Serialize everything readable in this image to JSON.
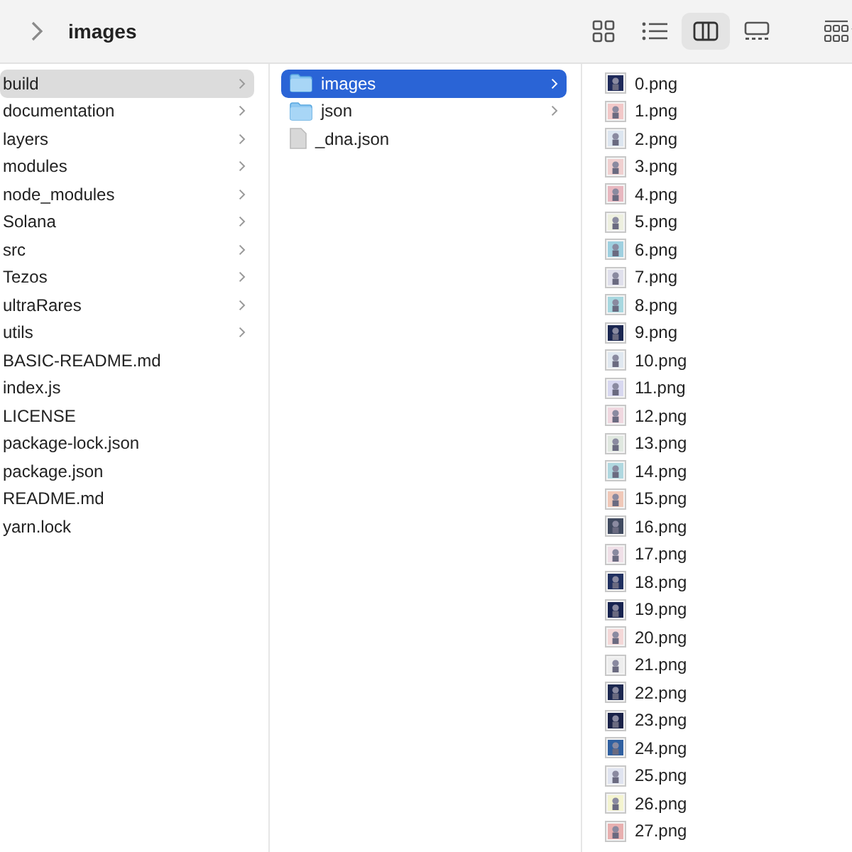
{
  "toolbar": {
    "title": "images",
    "views": [
      {
        "kind": "icons",
        "selected": false
      },
      {
        "kind": "list",
        "selected": false
      },
      {
        "kind": "columns",
        "selected": true
      },
      {
        "kind": "gallery",
        "selected": false
      }
    ]
  },
  "columns": [
    {
      "items": [
        {
          "name": "build",
          "kind": "folder",
          "selected": true
        },
        {
          "name": "documentation",
          "kind": "folder",
          "selected": false
        },
        {
          "name": "layers",
          "kind": "folder",
          "selected": false
        },
        {
          "name": "modules",
          "kind": "folder",
          "selected": false
        },
        {
          "name": "node_modules",
          "kind": "folder",
          "selected": false
        },
        {
          "name": "Solana",
          "kind": "folder",
          "selected": false
        },
        {
          "name": "src",
          "kind": "folder",
          "selected": false
        },
        {
          "name": "Tezos",
          "kind": "folder",
          "selected": false
        },
        {
          "name": "ultraRares",
          "kind": "folder",
          "selected": false
        },
        {
          "name": "utils",
          "kind": "folder",
          "selected": false
        },
        {
          "name": "BASIC-README.md",
          "kind": "file",
          "selected": false
        },
        {
          "name": "index.js",
          "kind": "file",
          "selected": false
        },
        {
          "name": "LICENSE",
          "kind": "file",
          "selected": false
        },
        {
          "name": "package-lock.json",
          "kind": "file",
          "selected": false
        },
        {
          "name": "package.json",
          "kind": "file",
          "selected": false
        },
        {
          "name": "README.md",
          "kind": "file",
          "selected": false
        },
        {
          "name": "yarn.lock",
          "kind": "file",
          "selected": false
        }
      ]
    },
    {
      "items": [
        {
          "name": "images",
          "kind": "folder",
          "selected": true
        },
        {
          "name": "json",
          "kind": "folder",
          "selected": false
        },
        {
          "name": "_dna.json",
          "kind": "file",
          "selected": false
        }
      ]
    },
    {
      "items": [
        {
          "name": "0.png",
          "kind": "image",
          "selected": false,
          "color": "#1f2a5a"
        },
        {
          "name": "1.png",
          "kind": "image",
          "selected": false,
          "color": "#f2c8c8"
        },
        {
          "name": "2.png",
          "kind": "image",
          "selected": false,
          "color": "#dde6f0"
        },
        {
          "name": "3.png",
          "kind": "image",
          "selected": false,
          "color": "#f0d0d0"
        },
        {
          "name": "4.png",
          "kind": "image",
          "selected": false,
          "color": "#e8b8c0"
        },
        {
          "name": "5.png",
          "kind": "image",
          "selected": false,
          "color": "#eef0e0"
        },
        {
          "name": "6.png",
          "kind": "image",
          "selected": false,
          "color": "#9fd0e0"
        },
        {
          "name": "7.png",
          "kind": "image",
          "selected": false,
          "color": "#e0e0ec"
        },
        {
          "name": "8.png",
          "kind": "image",
          "selected": false,
          "color": "#a8d8e0"
        },
        {
          "name": "9.png",
          "kind": "image",
          "selected": false,
          "color": "#1a2650"
        },
        {
          "name": "10.png",
          "kind": "image",
          "selected": false,
          "color": "#e0e8f0"
        },
        {
          "name": "11.png",
          "kind": "image",
          "selected": false,
          "color": "#d8d8f0"
        },
        {
          "name": "12.png",
          "kind": "image",
          "selected": false,
          "color": "#f0d8e0"
        },
        {
          "name": "13.png",
          "kind": "image",
          "selected": false,
          "color": "#e0e8e0"
        },
        {
          "name": "14.png",
          "kind": "image",
          "selected": false,
          "color": "#b0d8e0"
        },
        {
          "name": "15.png",
          "kind": "image",
          "selected": false,
          "color": "#f0c8b8"
        },
        {
          "name": "16.png",
          "kind": "image",
          "selected": false,
          "color": "#404a60"
        },
        {
          "name": "17.png",
          "kind": "image",
          "selected": false,
          "color": "#f0e0e8"
        },
        {
          "name": "18.png",
          "kind": "image",
          "selected": false,
          "color": "#203060"
        },
        {
          "name": "19.png",
          "kind": "image",
          "selected": false,
          "color": "#182450"
        },
        {
          "name": "20.png",
          "kind": "image",
          "selected": false,
          "color": "#f4d8d8"
        },
        {
          "name": "21.png",
          "kind": "image",
          "selected": false,
          "color": "#eeeeee"
        },
        {
          "name": "22.png",
          "kind": "image",
          "selected": false,
          "color": "#1c2850"
        },
        {
          "name": "23.png",
          "kind": "image",
          "selected": false,
          "color": "#1a2248"
        },
        {
          "name": "24.png",
          "kind": "image",
          "selected": false,
          "color": "#3060a0"
        },
        {
          "name": "25.png",
          "kind": "image",
          "selected": false,
          "color": "#e0e4f0"
        },
        {
          "name": "26.png",
          "kind": "image",
          "selected": false,
          "color": "#f4f4d0"
        },
        {
          "name": "27.png",
          "kind": "image",
          "selected": false,
          "color": "#e8b0b0"
        }
      ]
    }
  ]
}
